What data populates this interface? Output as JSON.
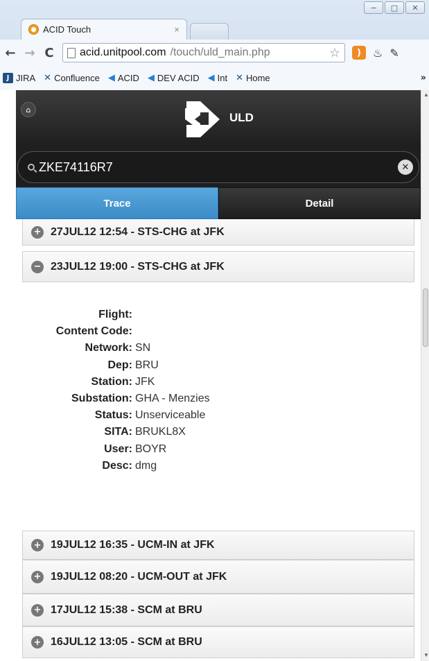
{
  "browser": {
    "tab_title": "ACID Touch",
    "tab_close": "×",
    "url_host": "acid.unitpool.com",
    "url_path": "/touch/uld_main.php",
    "bookmarks": [
      "JIRA",
      "Confluence",
      "ACID",
      "DEV ACID",
      "Int",
      "Home"
    ],
    "bookmarks_more": "»",
    "window_buttons": [
      "−",
      "□",
      "✕"
    ]
  },
  "header": {
    "title": "ULD"
  },
  "search": {
    "value": "ZKE74116R7"
  },
  "tabs": [
    {
      "label": "Trace",
      "active": true
    },
    {
      "label": "Detail",
      "active": false
    }
  ],
  "events": [
    {
      "label": "27JUL12 12:54 - STS-CHG at JFK",
      "expanded": false
    },
    {
      "label": "23JUL12 19:00 - STS-CHG at JFK",
      "expanded": true
    },
    {
      "label": "19JUL12 16:35 - UCM-IN at JFK",
      "expanded": false
    },
    {
      "label": "19JUL12 08:20 - UCM-OUT at JFK",
      "expanded": false
    },
    {
      "label": "17JUL12 15:38 - SCM at BRU",
      "expanded": false
    },
    {
      "label": "16JUL12 13:05 - SCM at BRU",
      "expanded": false
    }
  ],
  "details": [
    {
      "label": "Flight:",
      "value": ""
    },
    {
      "label": "Content Code:",
      "value": ""
    },
    {
      "label": "Network:",
      "value": "SN"
    },
    {
      "label": "Dep:",
      "value": "BRU"
    },
    {
      "label": "Station:",
      "value": "JFK"
    },
    {
      "label": "Substation:",
      "value": "GHA - Menzies"
    },
    {
      "label": "Status:",
      "value": "Unserviceable"
    },
    {
      "label": "SITA:",
      "value": "BRUKL8X"
    },
    {
      "label": "User:",
      "value": "BOYR"
    },
    {
      "label": "Desc:",
      "value": "dmg"
    }
  ],
  "icons": {
    "expand": "+",
    "collapse": "−"
  }
}
